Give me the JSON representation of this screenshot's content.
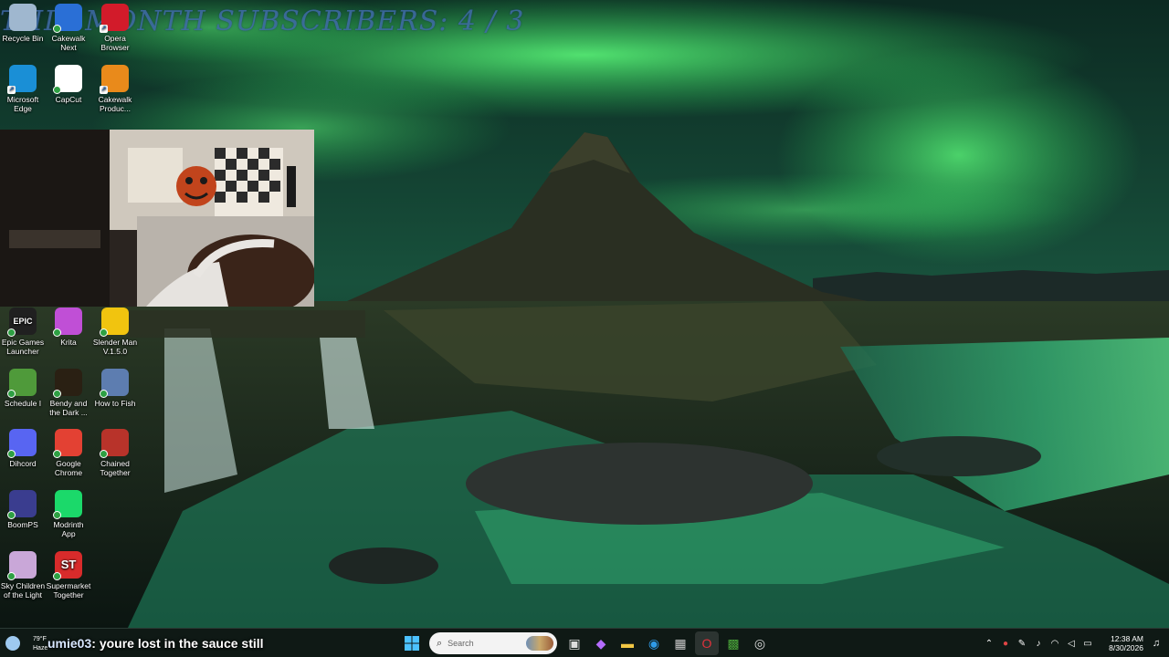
{
  "overlay": {
    "title": "THIS MONTH SUBSCRIBERS: 4 / 3"
  },
  "desktop_icons": [
    {
      "label": "Recycle Bin",
      "icon": "recycle-bin-icon",
      "color": "#9fb7cf"
    },
    {
      "label": "Cakewalk Next",
      "icon": "cakewalk-next-icon",
      "color": "#2a6fd6"
    },
    {
      "label": "Opera Browser",
      "icon": "opera-icon",
      "color": "#d21b2a"
    },
    {
      "label": "Microsoft Edge",
      "icon": "edge-icon",
      "color": "#1a8fd6"
    },
    {
      "label": "CapCut",
      "icon": "capcut-icon",
      "color": "#ffffff"
    },
    {
      "label": "Cakewalk Produc...",
      "icon": "cakewalk-producer-icon",
      "color": "#e98a1b"
    },
    {
      "label": "Epic Games Launcher",
      "icon": "epic-games-icon",
      "color": "#202020",
      "glyph": "EPIC"
    },
    {
      "label": "Krita",
      "icon": "krita-icon",
      "color": "#c04fd6"
    },
    {
      "label": "Slender Man V.1.5.0",
      "icon": "folder-icon",
      "color": "#f1c40f"
    },
    {
      "label": "Schedule I",
      "icon": "schedule-i-icon",
      "color": "#4f9a3a"
    },
    {
      "label": "Bendy and the Dark ...",
      "icon": "bendy-icon",
      "color": "#2a2013"
    },
    {
      "label": "How to Fish",
      "icon": "how-to-fish-icon",
      "color": "#5d7db0"
    },
    {
      "label": "Dihcord",
      "icon": "discord-icon",
      "color": "#5865f2"
    },
    {
      "label": "Google Chrome",
      "icon": "chrome-icon",
      "color": "#e34133"
    },
    {
      "label": "Chained Together",
      "icon": "chained-together-icon",
      "color": "#b8332a"
    },
    {
      "label": "BoomPS",
      "icon": "boomps-icon",
      "color": "#3a3d8f"
    },
    {
      "label": "Modrinth App",
      "icon": "modrinth-icon",
      "color": "#1bd96a"
    },
    {
      "label": "Sky Children of the Light",
      "icon": "sky-icon",
      "color": "#c9a7d8"
    },
    {
      "label": "Supermarket Together",
      "icon": "supermarket-together-icon",
      "color": "#d82b2b",
      "glyph": "ST"
    }
  ],
  "chat": {
    "user": "umie03",
    "separator": ": ",
    "message": "youre lost in the sauce still"
  },
  "weather": {
    "temp": "79°F",
    "condition": "Haze"
  },
  "taskbar": {
    "search_placeholder": "Search",
    "apps": [
      {
        "name": "task-view-icon",
        "glyph": "▣"
      },
      {
        "name": "copilot-icon",
        "glyph": "◆"
      },
      {
        "name": "file-explorer-icon",
        "glyph": "▬"
      },
      {
        "name": "edge-taskbar-icon",
        "glyph": "◉"
      },
      {
        "name": "microsoft-store-icon",
        "glyph": "▦"
      },
      {
        "name": "opera-taskbar-icon",
        "glyph": "O"
      },
      {
        "name": "minecraft-icon",
        "glyph": "▩"
      },
      {
        "name": "obs-icon",
        "glyph": "◎"
      }
    ]
  },
  "tray": {
    "time": "12:38 AM",
    "date": "8/30/2026"
  }
}
